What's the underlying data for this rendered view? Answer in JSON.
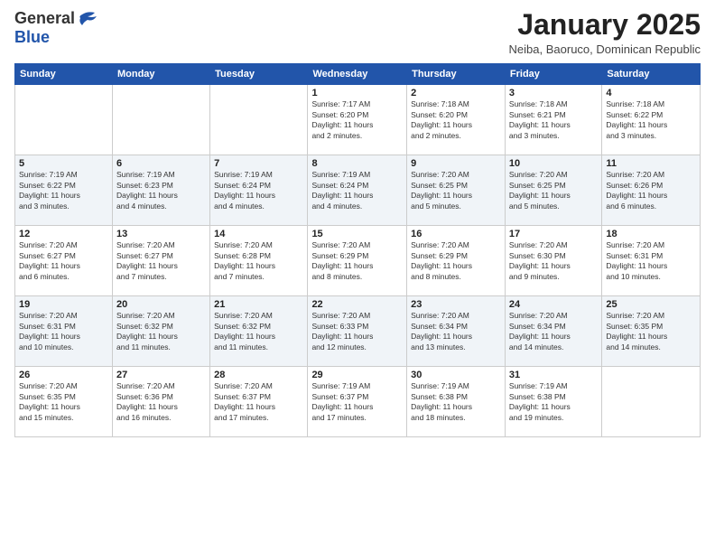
{
  "logo": {
    "text_general": "General",
    "text_blue": "Blue"
  },
  "header": {
    "month": "January 2025",
    "location": "Neiba, Baoruco, Dominican Republic"
  },
  "days_of_week": [
    "Sunday",
    "Monday",
    "Tuesday",
    "Wednesday",
    "Thursday",
    "Friday",
    "Saturday"
  ],
  "weeks": [
    [
      {
        "day": "",
        "info": ""
      },
      {
        "day": "",
        "info": ""
      },
      {
        "day": "",
        "info": ""
      },
      {
        "day": "1",
        "info": "Sunrise: 7:17 AM\nSunset: 6:20 PM\nDaylight: 11 hours\nand 2 minutes."
      },
      {
        "day": "2",
        "info": "Sunrise: 7:18 AM\nSunset: 6:20 PM\nDaylight: 11 hours\nand 2 minutes."
      },
      {
        "day": "3",
        "info": "Sunrise: 7:18 AM\nSunset: 6:21 PM\nDaylight: 11 hours\nand 3 minutes."
      },
      {
        "day": "4",
        "info": "Sunrise: 7:18 AM\nSunset: 6:22 PM\nDaylight: 11 hours\nand 3 minutes."
      }
    ],
    [
      {
        "day": "5",
        "info": "Sunrise: 7:19 AM\nSunset: 6:22 PM\nDaylight: 11 hours\nand 3 minutes."
      },
      {
        "day": "6",
        "info": "Sunrise: 7:19 AM\nSunset: 6:23 PM\nDaylight: 11 hours\nand 4 minutes."
      },
      {
        "day": "7",
        "info": "Sunrise: 7:19 AM\nSunset: 6:24 PM\nDaylight: 11 hours\nand 4 minutes."
      },
      {
        "day": "8",
        "info": "Sunrise: 7:19 AM\nSunset: 6:24 PM\nDaylight: 11 hours\nand 4 minutes."
      },
      {
        "day": "9",
        "info": "Sunrise: 7:20 AM\nSunset: 6:25 PM\nDaylight: 11 hours\nand 5 minutes."
      },
      {
        "day": "10",
        "info": "Sunrise: 7:20 AM\nSunset: 6:25 PM\nDaylight: 11 hours\nand 5 minutes."
      },
      {
        "day": "11",
        "info": "Sunrise: 7:20 AM\nSunset: 6:26 PM\nDaylight: 11 hours\nand 6 minutes."
      }
    ],
    [
      {
        "day": "12",
        "info": "Sunrise: 7:20 AM\nSunset: 6:27 PM\nDaylight: 11 hours\nand 6 minutes."
      },
      {
        "day": "13",
        "info": "Sunrise: 7:20 AM\nSunset: 6:27 PM\nDaylight: 11 hours\nand 7 minutes."
      },
      {
        "day": "14",
        "info": "Sunrise: 7:20 AM\nSunset: 6:28 PM\nDaylight: 11 hours\nand 7 minutes."
      },
      {
        "day": "15",
        "info": "Sunrise: 7:20 AM\nSunset: 6:29 PM\nDaylight: 11 hours\nand 8 minutes."
      },
      {
        "day": "16",
        "info": "Sunrise: 7:20 AM\nSunset: 6:29 PM\nDaylight: 11 hours\nand 8 minutes."
      },
      {
        "day": "17",
        "info": "Sunrise: 7:20 AM\nSunset: 6:30 PM\nDaylight: 11 hours\nand 9 minutes."
      },
      {
        "day": "18",
        "info": "Sunrise: 7:20 AM\nSunset: 6:31 PM\nDaylight: 11 hours\nand 10 minutes."
      }
    ],
    [
      {
        "day": "19",
        "info": "Sunrise: 7:20 AM\nSunset: 6:31 PM\nDaylight: 11 hours\nand 10 minutes."
      },
      {
        "day": "20",
        "info": "Sunrise: 7:20 AM\nSunset: 6:32 PM\nDaylight: 11 hours\nand 11 minutes."
      },
      {
        "day": "21",
        "info": "Sunrise: 7:20 AM\nSunset: 6:32 PM\nDaylight: 11 hours\nand 11 minutes."
      },
      {
        "day": "22",
        "info": "Sunrise: 7:20 AM\nSunset: 6:33 PM\nDaylight: 11 hours\nand 12 minutes."
      },
      {
        "day": "23",
        "info": "Sunrise: 7:20 AM\nSunset: 6:34 PM\nDaylight: 11 hours\nand 13 minutes."
      },
      {
        "day": "24",
        "info": "Sunrise: 7:20 AM\nSunset: 6:34 PM\nDaylight: 11 hours\nand 14 minutes."
      },
      {
        "day": "25",
        "info": "Sunrise: 7:20 AM\nSunset: 6:35 PM\nDaylight: 11 hours\nand 14 minutes."
      }
    ],
    [
      {
        "day": "26",
        "info": "Sunrise: 7:20 AM\nSunset: 6:35 PM\nDaylight: 11 hours\nand 15 minutes."
      },
      {
        "day": "27",
        "info": "Sunrise: 7:20 AM\nSunset: 6:36 PM\nDaylight: 11 hours\nand 16 minutes."
      },
      {
        "day": "28",
        "info": "Sunrise: 7:20 AM\nSunset: 6:37 PM\nDaylight: 11 hours\nand 17 minutes."
      },
      {
        "day": "29",
        "info": "Sunrise: 7:19 AM\nSunset: 6:37 PM\nDaylight: 11 hours\nand 17 minutes."
      },
      {
        "day": "30",
        "info": "Sunrise: 7:19 AM\nSunset: 6:38 PM\nDaylight: 11 hours\nand 18 minutes."
      },
      {
        "day": "31",
        "info": "Sunrise: 7:19 AM\nSunset: 6:38 PM\nDaylight: 11 hours\nand 19 minutes."
      },
      {
        "day": "",
        "info": ""
      }
    ]
  ]
}
